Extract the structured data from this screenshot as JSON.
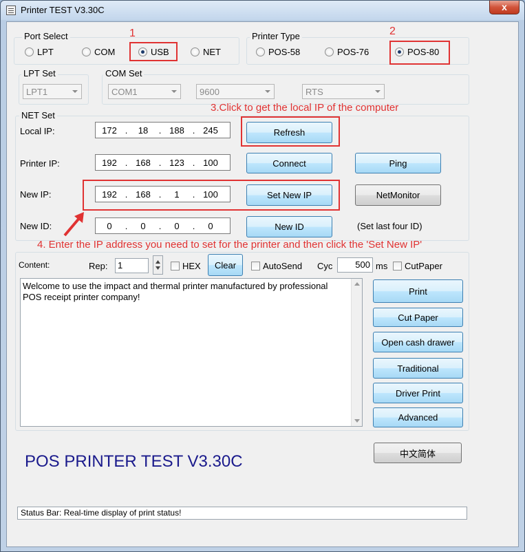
{
  "window": {
    "title": "Printer TEST V3.30C",
    "close_glyph": "x"
  },
  "port_select": {
    "title": "Port Select",
    "options": [
      "LPT",
      "COM",
      "USB",
      "NET"
    ],
    "selected": "USB"
  },
  "printer_type": {
    "title": "Printer Type",
    "options": [
      "POS-58",
      "POS-76",
      "POS-80"
    ],
    "selected": "POS-80"
  },
  "lpt_set": {
    "title": "LPT Set",
    "value": "LPT1"
  },
  "com_set": {
    "title": "COM Set",
    "port": "COM1",
    "baud": "9600",
    "flow": "RTS"
  },
  "net_set": {
    "title": "NET Set",
    "local_ip_label": "Local IP:",
    "local_ip": [
      "172",
      "18",
      "188",
      "245"
    ],
    "printer_ip_label": "Printer IP:",
    "printer_ip": [
      "192",
      "168",
      "123",
      "100"
    ],
    "new_ip_label": "New IP:",
    "new_ip": [
      "192",
      "168",
      "1",
      "100"
    ],
    "new_id_label": "New ID:",
    "new_id": [
      "0",
      "0",
      "0",
      "0"
    ],
    "dot": ".",
    "refresh_label": "Refresh",
    "connect_label": "Connect",
    "ping_label": "Ping",
    "set_new_ip_label": "Set New IP",
    "netmonitor_label": "NetMonitor",
    "new_id_button_label": "New ID",
    "new_id_hint": "(Set last four ID)"
  },
  "annotations": {
    "step1": "1",
    "step2": "2",
    "step3": "3.Click to get the local IP of the computer",
    "step4": "4. Enter the IP address you need to set for the printer and then click the 'Set New IP'",
    "color": "#e03232"
  },
  "content": {
    "label": "Content:",
    "rep_label": "Rep:",
    "rep_value": "1",
    "hex_label": "HEX",
    "clear_label": "Clear",
    "autosend_label": "AutoSend",
    "cyc_label": "Cyc",
    "cyc_value": "500",
    "ms_label": "ms",
    "cutpaper_check_label": "CutPaper",
    "text": "Welcome to use the impact and thermal printer manufactured by professional POS receipt printer company!"
  },
  "actions": {
    "print": "Print",
    "cut_paper": "Cut Paper",
    "open_cash_drawer": "Open cash drawer",
    "traditional": "Traditional",
    "driver_print": "Driver Print",
    "advanced": "Advanced",
    "language": "中文简体"
  },
  "banner": {
    "text": "POS PRINTER TEST V3.30C",
    "color": "#1a1a8c"
  },
  "status_bar": {
    "text": "Status Bar: Real-time display of print status!"
  }
}
